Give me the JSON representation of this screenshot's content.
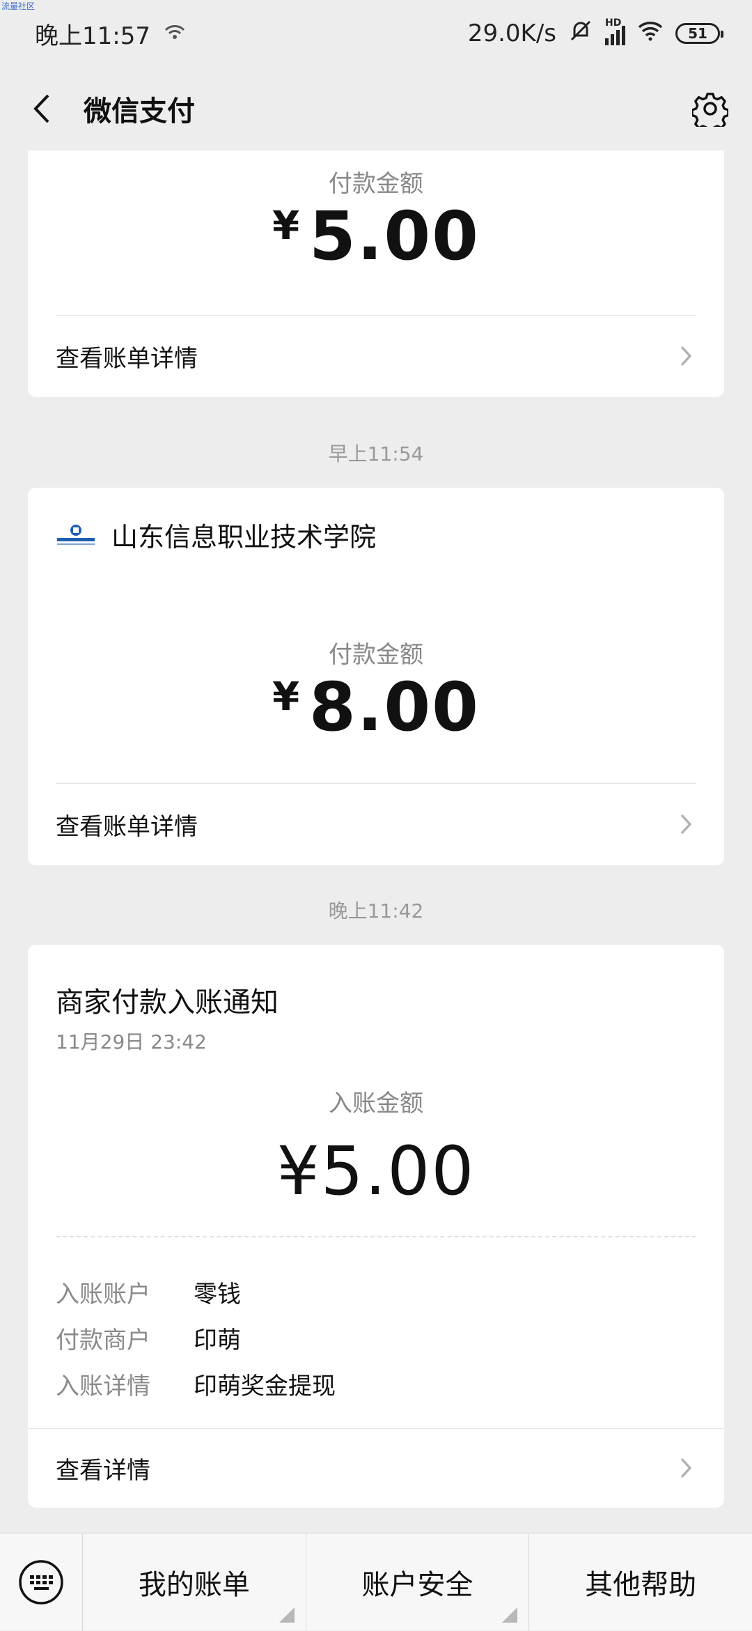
{
  "status_bar": {
    "watermark": "流量社区",
    "time": "晚上11:57",
    "net_speed": "29.0K/s",
    "signal_label": "HD",
    "battery": "51"
  },
  "nav": {
    "title": "微信支付"
  },
  "cards": [
    {
      "amount_label": "付款金额",
      "currency": "¥",
      "amount": "5.00",
      "link_label": "查看账单详情"
    },
    {
      "time": "早上11:54",
      "merchant": "山东信息职业技术学院",
      "logo_text": "中国建设银行",
      "amount_label": "付款金额",
      "currency": "¥",
      "amount": "8.00",
      "link_label": "查看账单详情"
    },
    {
      "time": "晚上11:42",
      "title": "商家付款入账通知",
      "date": "11月29日  23:42",
      "amount_label": "入账金额",
      "amount": "¥5.00",
      "details": [
        {
          "key": "入账账户",
          "value": "零钱"
        },
        {
          "key": "付款商户",
          "value": "印萌"
        },
        {
          "key": "入账详情",
          "value": "印萌奖金提现"
        }
      ],
      "link_label": "查看详情"
    }
  ],
  "bottom_menu": [
    {
      "label": "我的账单"
    },
    {
      "label": "账户安全"
    },
    {
      "label": "其他帮助"
    }
  ]
}
